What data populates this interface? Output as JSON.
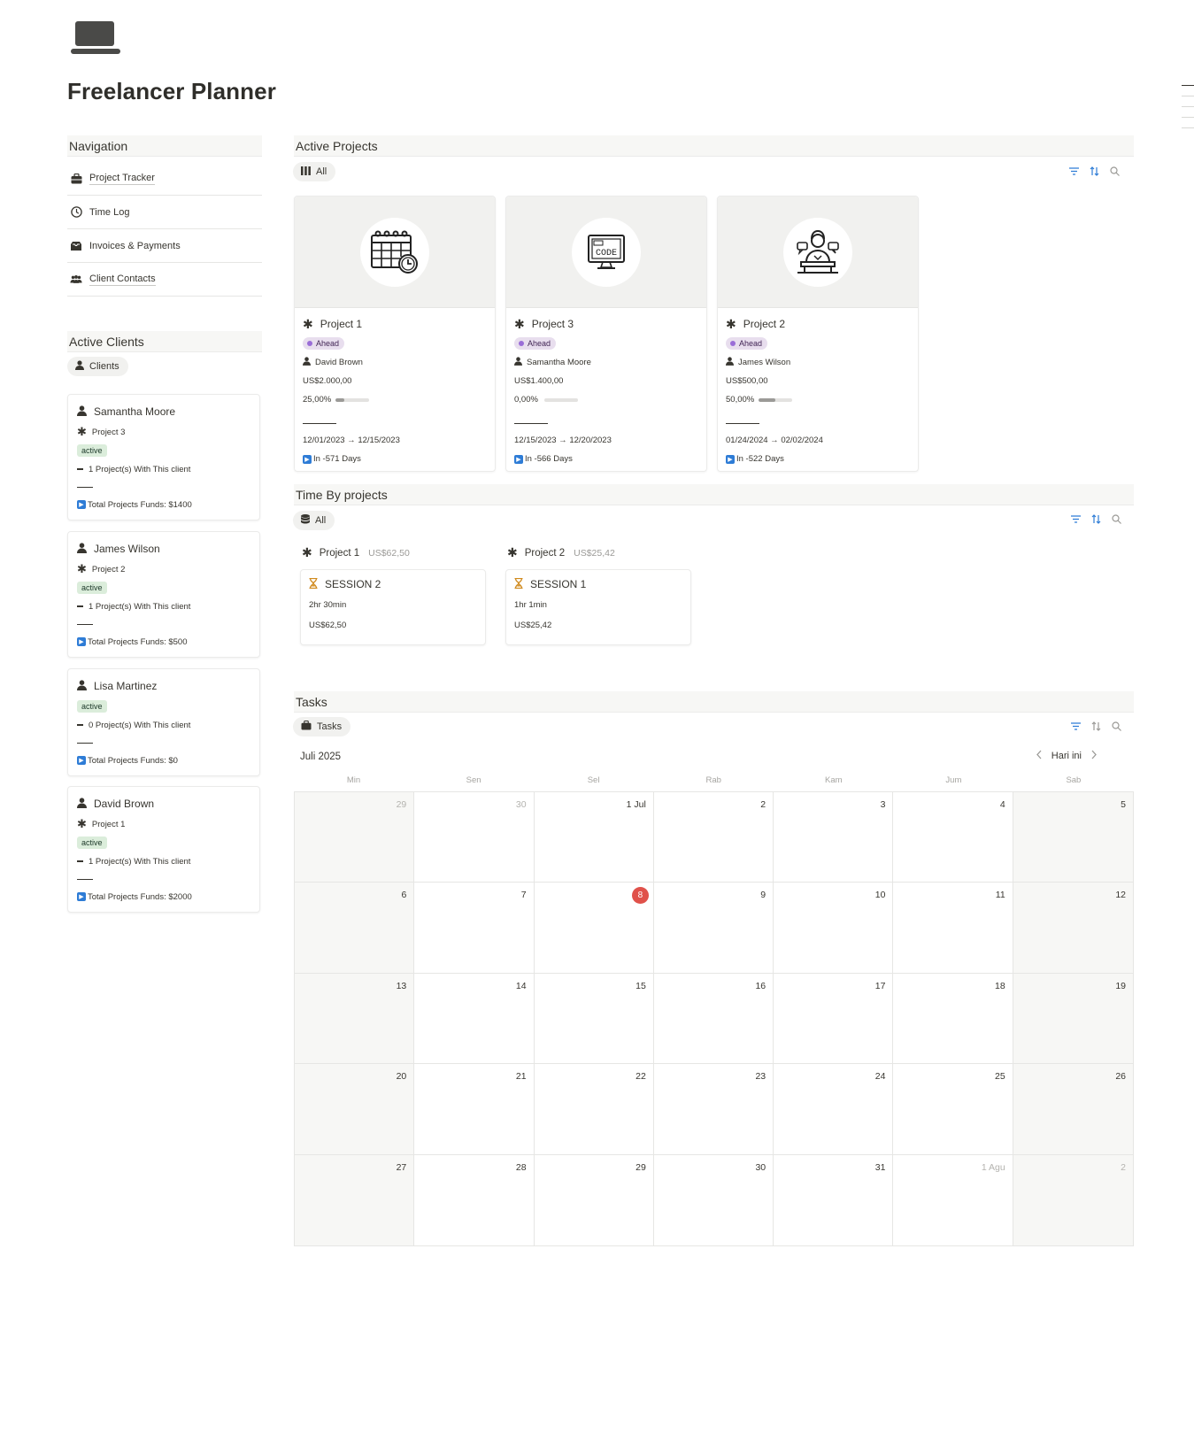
{
  "page": {
    "title": "Freelancer Planner",
    "icon": "laptop-icon"
  },
  "navigation": {
    "header": "Navigation",
    "items": [
      {
        "label": "Project Tracker",
        "icon": "briefcase-icon"
      },
      {
        "label": "Time Log",
        "icon": "clock-icon"
      },
      {
        "label": "Invoices & Payments",
        "icon": "inbox-icon"
      },
      {
        "label": "Client Contacts",
        "icon": "people-icon"
      }
    ]
  },
  "active_clients": {
    "header": "Active Clients",
    "tab": "Clients",
    "cards": [
      {
        "name": "Samantha Moore",
        "project": "Project 3",
        "status": "active",
        "count": "1 Project(s) With This client",
        "funds": "Total Projects Funds: $1400"
      },
      {
        "name": "James Wilson",
        "project": "Project 2",
        "status": "active",
        "count": "1 Project(s) With This client",
        "funds": "Total Projects Funds: $500"
      },
      {
        "name": "Lisa Martinez",
        "project": "",
        "status": "active",
        "count": "0 Project(s) With This client",
        "funds": "Total Projects Funds: $0"
      },
      {
        "name": "David Brown",
        "project": "Project 1",
        "status": "active",
        "count": "1 Project(s) With This client",
        "funds": "Total Projects Funds: $2000"
      }
    ]
  },
  "active_projects": {
    "header": "Active Projects",
    "tab": "All",
    "cards": [
      {
        "title": "Project 1",
        "status": "Ahead",
        "client": "David Brown",
        "budget": "US$2.000,00",
        "progress_label": "25,00%",
        "progress": 0.25,
        "dates": "12/01/2023 → 12/15/2023",
        "due": "In -571 Days",
        "cover_icon": "calendar-clock-icon"
      },
      {
        "title": "Project 3",
        "status": "Ahead",
        "client": "Samantha Moore",
        "budget": "US$1.400,00",
        "progress_label": "0,00%",
        "progress": 0.0,
        "dates": "12/15/2023 → 12/20/2023",
        "due": "In -566 Days",
        "cover_icon": "code-monitor-icon"
      },
      {
        "title": "Project 2",
        "status": "Ahead",
        "client": "James Wilson",
        "budget": "US$500,00",
        "progress_label": "50,00%",
        "progress": 0.5,
        "dates": "01/24/2024 → 02/02/2024",
        "due": "In -522 Days",
        "cover_icon": "speaker-icon"
      }
    ]
  },
  "time_by_projects": {
    "header": "Time By projects",
    "tab": "All",
    "groups": [
      {
        "title": "Project 1",
        "amount": "US$62,50",
        "session": {
          "title": "SESSION 2",
          "duration": "2hr 30min",
          "amount": "US$62,50"
        }
      },
      {
        "title": "Project 2",
        "amount": "US$25,42",
        "session": {
          "title": "SESSION 1",
          "duration": "1hr 1min",
          "amount": "US$25,42"
        }
      }
    ]
  },
  "tasks": {
    "header": "Tasks",
    "tab": "Tasks",
    "month": "Juli 2025",
    "today_label": "Hari ini",
    "weekdays": [
      "Min",
      "Sen",
      "Sel",
      "Rab",
      "Kam",
      "Jum",
      "Sab"
    ],
    "days": [
      "29",
      "30",
      "1 Jul",
      "2",
      "3",
      "4",
      "5",
      "6",
      "7",
      "8",
      "9",
      "10",
      "11",
      "12",
      "13",
      "14",
      "15",
      "16",
      "17",
      "18",
      "19",
      "20",
      "21",
      "22",
      "23",
      "24",
      "25",
      "26",
      "27",
      "28",
      "29",
      "30",
      "31",
      "1 Agu",
      "2"
    ],
    "today": "8"
  },
  "colors": {
    "accent_blue": "#2e7cd6",
    "today_red": "#e0514a",
    "status_purple": "#e8deee",
    "status_green": "#dbeddb"
  }
}
